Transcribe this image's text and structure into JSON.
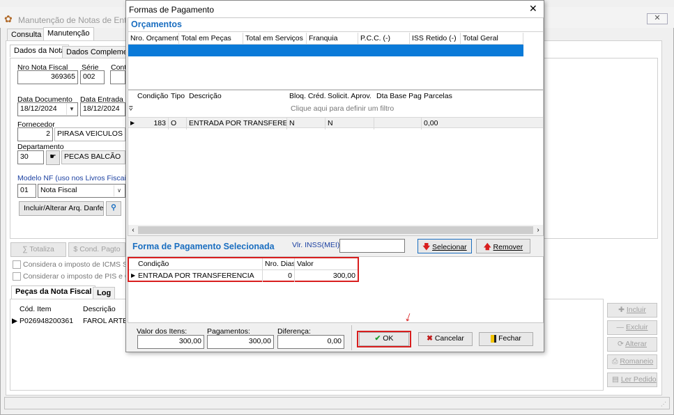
{
  "background": {
    "title": "Manutenção de Notas de Entrad",
    "tabs": [
      "Consulta",
      "Manutenção"
    ],
    "subtabs": [
      "Dados da Nota",
      "Dados Complementa"
    ],
    "nro_nota_label": "Nro Nota Fiscal",
    "nro_nota_value": "369365",
    "serie_label": "Série",
    "serie_value": "002",
    "cont_label": "Cont",
    "data_doc_label": "Data Documento",
    "data_doc_value": "18/12/2024",
    "data_entrada_label": "Data Entrada",
    "data_entrada_value": "18/12/2024",
    "fornecedor_label": "Fornecedor",
    "fornecedor_code": "2",
    "fornecedor_name": "PIRASA VEICULOS LTD",
    "departamento_label": "Departamento",
    "departamento_code": "30",
    "departamento_name": "PECAS BALCÃO",
    "modelo_label": "Modelo NF (uso nos Livros Fiscais)",
    "modelo_code": "01",
    "modelo_name": "Nota Fiscal",
    "danfe_button": "Incluir/Alterar Arq. Danfe",
    "totaliza_button": "Totaliza",
    "cond_pagto_button": "Cond. Pagto",
    "check_icms": "Considera o imposto de ICMS ST /",
    "check_pis": "Considerar o imposto de PIS e CO",
    "bottom_tabs": [
      "Peças da Nota Fiscal",
      "Log"
    ],
    "items_headers": [
      "Cód. Item",
      "Descrição"
    ],
    "items_rows": [
      [
        "P026948200361",
        "FAROL ARTEB"
      ]
    ],
    "side_buttons": [
      "Incluir",
      "Excluir",
      "Alterar",
      "Romaneio",
      "Ler Pedido"
    ]
  },
  "dialog": {
    "title": "Formas de Pagamento",
    "close_glyph": "✕",
    "orcamentos_title": "Orçamentos",
    "orcamentos_headers": [
      "Nro. Orçamento",
      "Total em Peças",
      "Total em Serviços",
      "Franquia",
      "P.C.C. (-)",
      "ISS Retido (-)",
      "Total Geral"
    ],
    "cond_headers": [
      "Condição",
      "Tipo",
      "Descrição",
      "Bloq. Créd.",
      "Solicit. Aprov.",
      "Dta Base Pag.",
      "Parcelas"
    ],
    "filter_hint": "Clique aqui para definir um filtro",
    "cond_row": {
      "codigo": "183",
      "tipo": "O",
      "descricao": "ENTRADA POR TRANSFERENCIA",
      "bloq": "N",
      "solicit": "N",
      "dta": "",
      "parcelas": "0,00"
    },
    "forma_title": "Forma de Pagamento Selecionada",
    "inss_label": "Vlr. INSS(MEI):",
    "inss_value": "",
    "selecionar_button": "Selecionar",
    "remover_button": "Remover",
    "selected_headers": [
      "Condição",
      "Nro. Dias",
      "Valor"
    ],
    "selected_row": {
      "condicao": "ENTRADA POR TRANSFERENCIA",
      "dias": "0",
      "valor": "300,00"
    },
    "valor_itens_label": "Valor dos Itens:",
    "valor_itens_value": "300,00",
    "pagamentos_label": "Pagamentos:",
    "pagamentos_value": "300,00",
    "diferenca_label": "Diferença:",
    "diferenca_value": "0,00",
    "ok_button": "OK",
    "cancelar_button": "Cancelar",
    "fechar_button": "Fechar"
  },
  "colors": {
    "accent": "#1a6ec0",
    "highlight": "#d81e1e",
    "selection": "#0a7ad8"
  }
}
